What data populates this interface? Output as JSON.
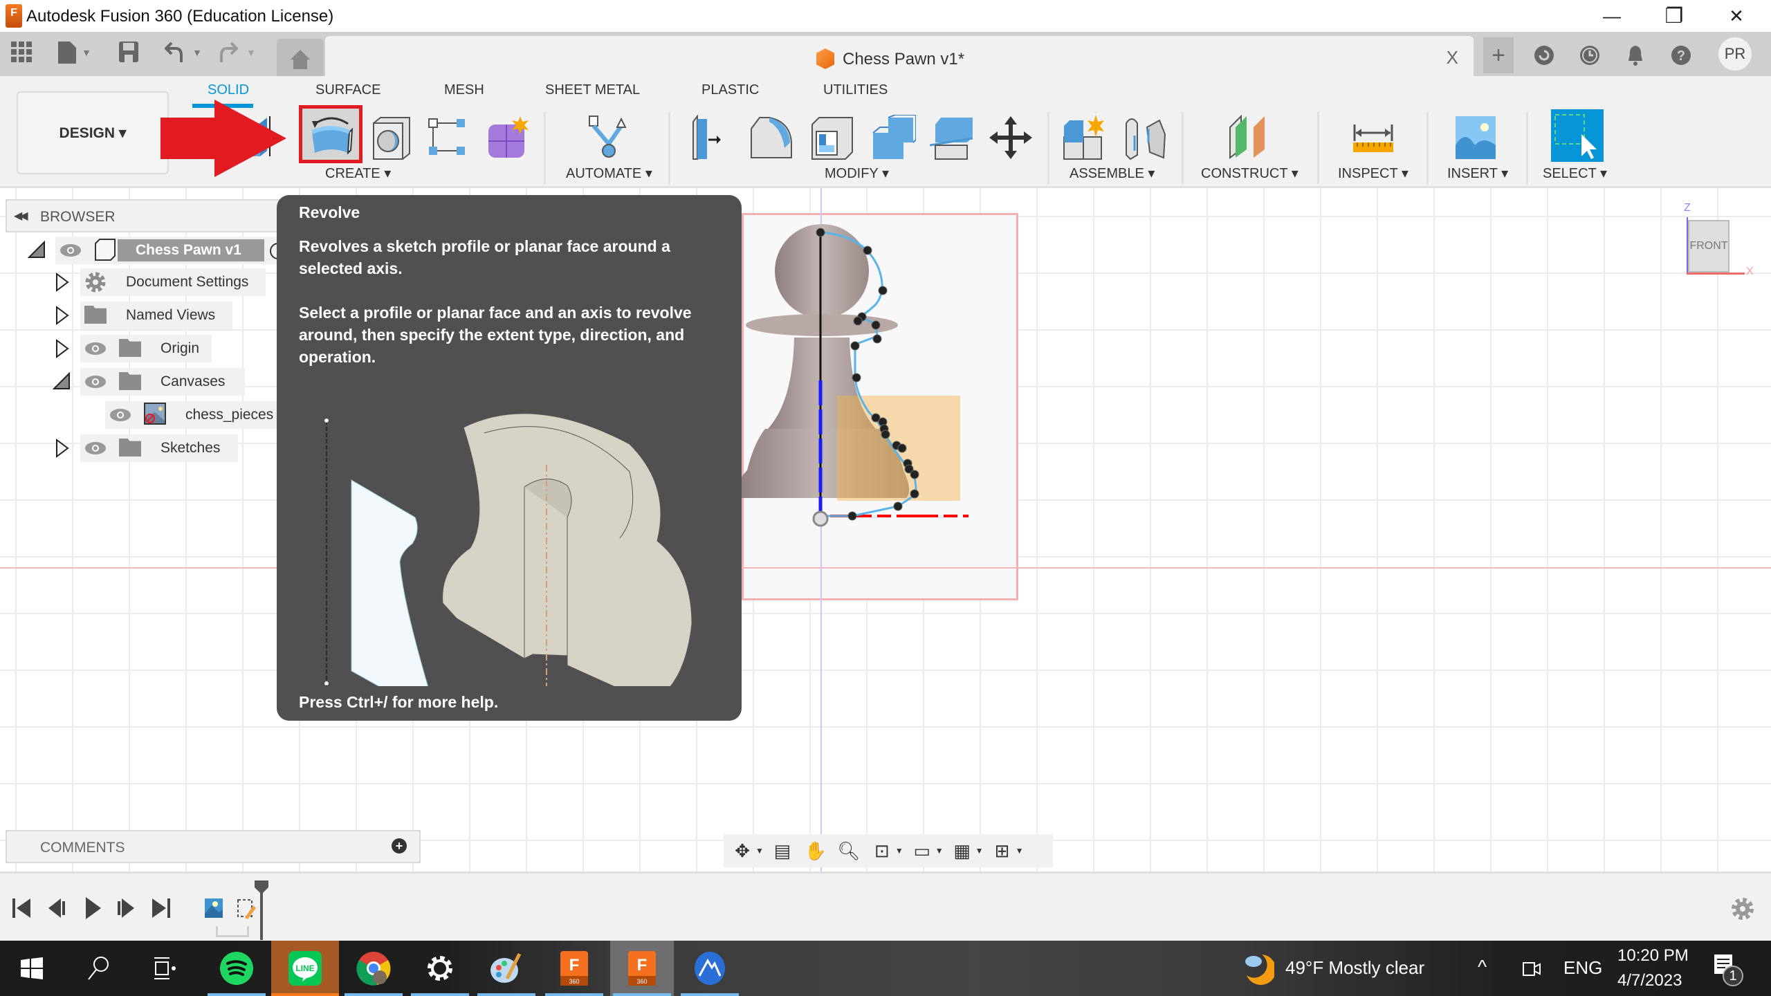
{
  "window": {
    "title": "Autodesk Fusion 360 (Education License)",
    "controls": {
      "minimize": "—",
      "restore": "❐",
      "close": "✕"
    }
  },
  "appbar": {
    "document_tab": "Chess Pawn v1*",
    "document_close": "X",
    "quick_access": [
      "grid-menu",
      "file",
      "save",
      "undo",
      "redo"
    ],
    "right_icons": [
      "new-tab",
      "job-status",
      "history",
      "notifications",
      "help"
    ],
    "avatar_initials": "PR"
  },
  "ribbon": {
    "workspace": "DESIGN ▾",
    "tabs": [
      {
        "label": "SOLID",
        "active": true
      },
      {
        "label": "SURFACE",
        "active": false
      },
      {
        "label": "MESH",
        "active": false
      },
      {
        "label": "SHEET METAL",
        "active": false
      },
      {
        "label": "PLASTIC",
        "active": false
      },
      {
        "label": "UTILITIES",
        "active": false
      }
    ],
    "groups": {
      "create": "CREATE ▾",
      "automate": "AUTOMATE ▾",
      "modify": "MODIFY ▾",
      "assemble": "ASSEMBLE ▾",
      "construct": "CONSTRUCT ▾",
      "inspect": "INSPECT ▾",
      "insert": "INSERT ▾",
      "select": "SELECT ▾"
    },
    "highlighted_tool": "Revolve",
    "accent_color": "#0696d7",
    "highlight_color": "#e21a22"
  },
  "browser": {
    "title": "BROWSER",
    "root": "Chess Pawn v1",
    "items": [
      {
        "label": "Document Settings",
        "expanded": false
      },
      {
        "label": "Named Views",
        "expanded": false
      },
      {
        "label": "Origin",
        "expanded": false
      },
      {
        "label": "Canvases",
        "expanded": true
      },
      {
        "label": "chess_pieces",
        "expanded": null
      },
      {
        "label": "Sketches",
        "expanded": false
      }
    ]
  },
  "tooltip": {
    "title": "Revolve",
    "description": "Revolves a sketch profile or planar face around a selected axis.",
    "instructions": "Select a profile or planar face and an axis to revolve around, then specify the extent type, direction, and operation.",
    "help": "Press Ctrl+/ for more help."
  },
  "viewcube": {
    "face": "FRONT",
    "axis_z": "Z",
    "axis_x": "X"
  },
  "comments": {
    "label": "COMMENTS"
  },
  "taskbar": {
    "apps": [
      "start",
      "search",
      "task-view",
      "spotify",
      "line",
      "chrome",
      "settings",
      "paint",
      "fusion-360",
      "fusion-360",
      "nordvpn"
    ],
    "weather": "49°F  Mostly clear",
    "language": "ENG",
    "time": "10:20 PM",
    "date": "4/7/2023",
    "notification_count": "1"
  }
}
